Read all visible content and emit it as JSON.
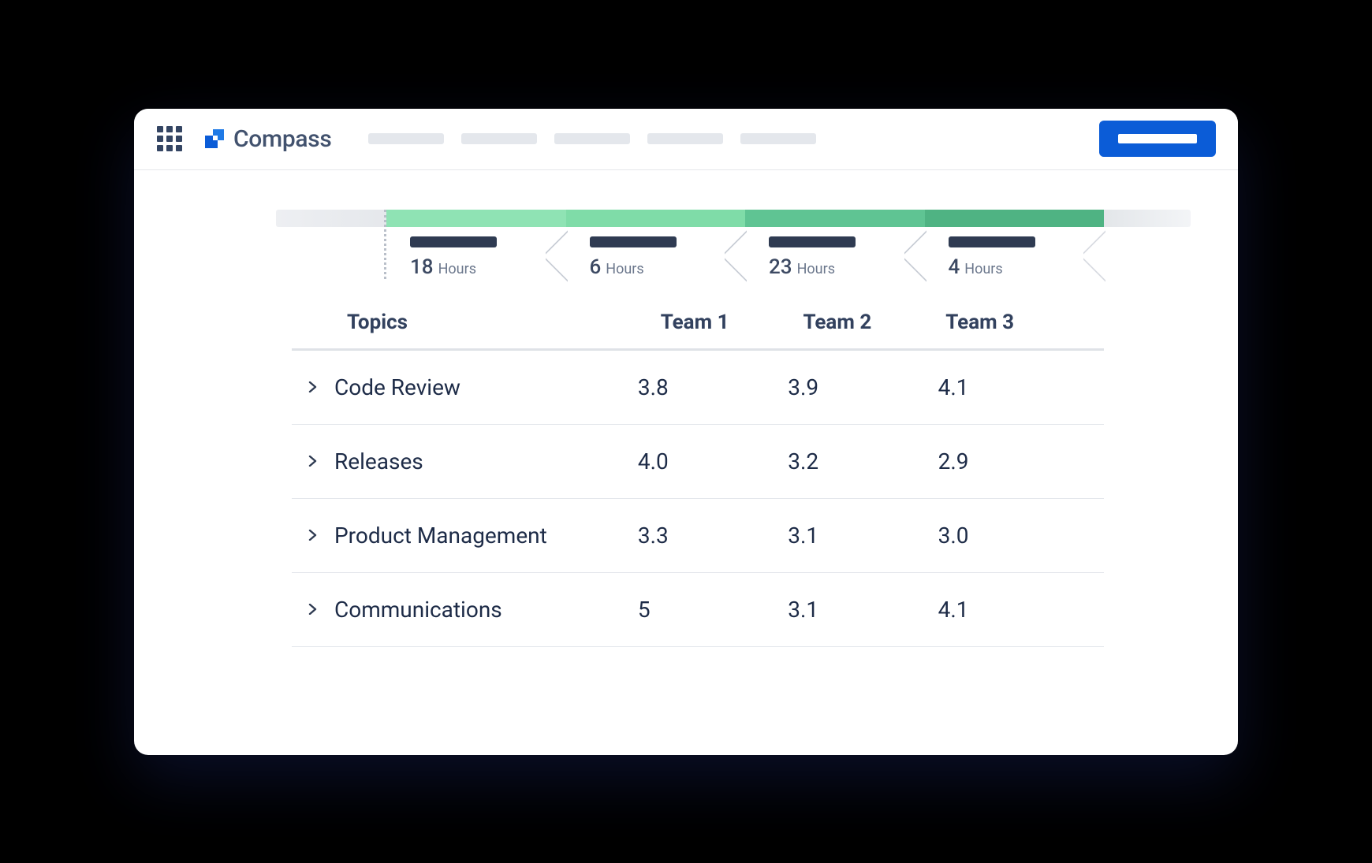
{
  "brand": {
    "name": "Compass"
  },
  "timeline": {
    "unit": "Hours",
    "steps": [
      {
        "value": "18"
      },
      {
        "value": "6"
      },
      {
        "value": "23"
      },
      {
        "value": "4"
      }
    ]
  },
  "table": {
    "headers": {
      "topics": "Topics",
      "team1": "Team 1",
      "team2": "Team 2",
      "team3": "Team 3"
    },
    "rows": [
      {
        "topic": "Code Review",
        "team1": "3.8",
        "team2": "3.9",
        "team3": "4.1"
      },
      {
        "topic": "Releases",
        "team1": "4.0",
        "team2": "3.2",
        "team3": "2.9"
      },
      {
        "topic": "Product Management",
        "team1": "3.3",
        "team2": "3.1",
        "team3": "3.0"
      },
      {
        "topic": "Communications",
        "team1": "5",
        "team2": "3.1",
        "team3": "4.1"
      }
    ]
  }
}
